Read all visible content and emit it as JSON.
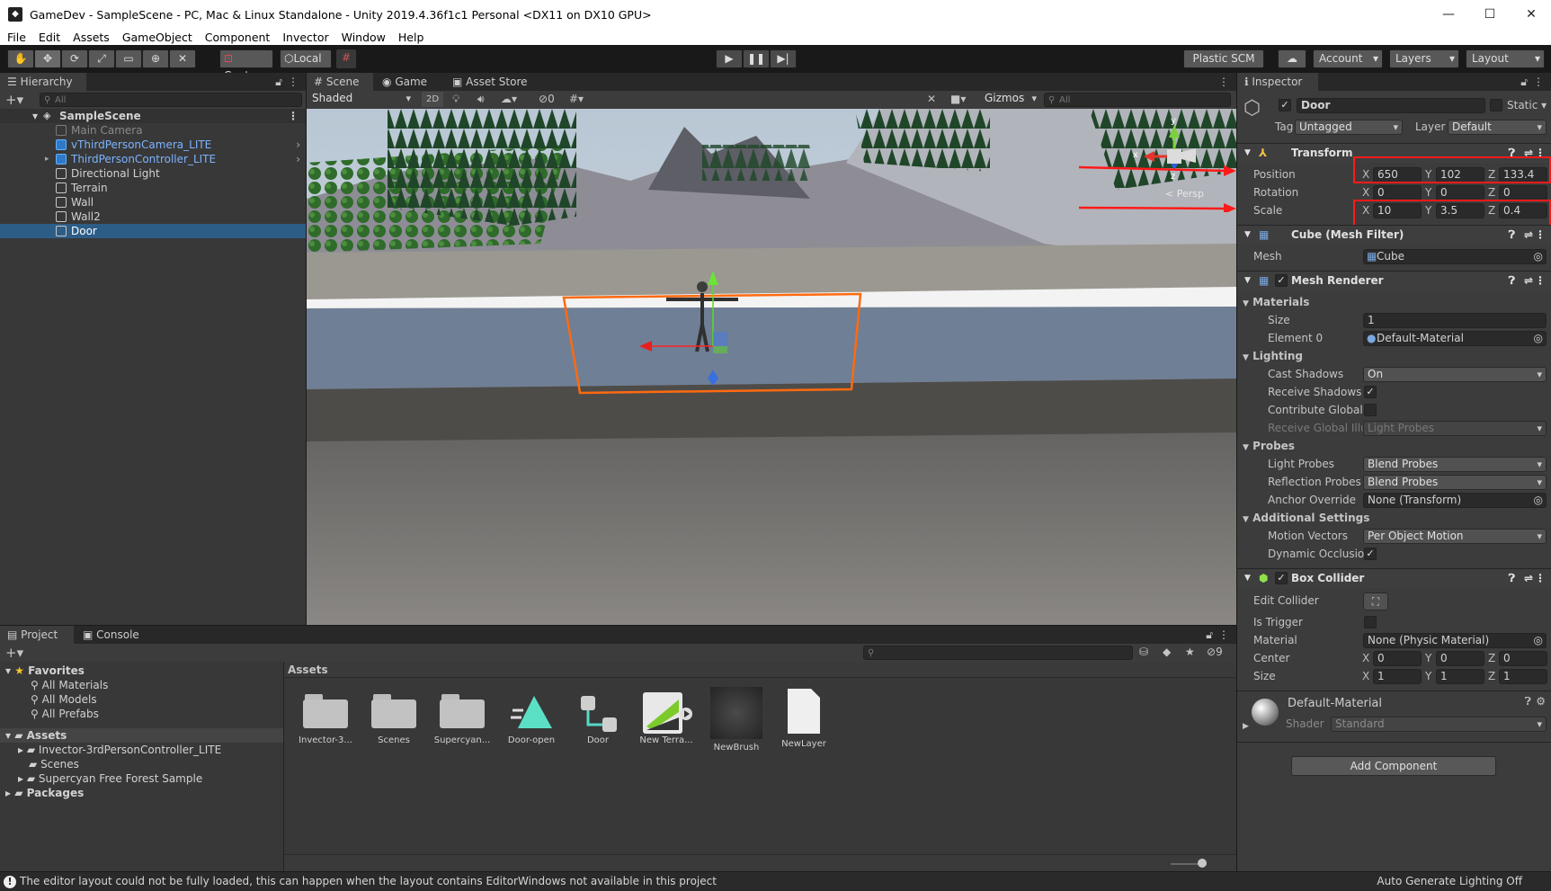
{
  "window": {
    "title": "GameDev - SampleScene - PC, Mac & Linux Standalone - Unity 2019.4.36f1c1 Personal <DX11 on DX10 GPU>",
    "minimize": "—",
    "maximize": "☐",
    "close": "✕"
  },
  "menu": [
    "File",
    "Edit",
    "Assets",
    "GameObject",
    "Component",
    "Invector",
    "Window",
    "Help"
  ],
  "toolbar": {
    "center": "Center",
    "local": "Local",
    "plastic": "Plastic SCM",
    "account": "Account",
    "layers": "Layers",
    "layout": "Layout"
  },
  "hierarchy": {
    "tab": "Hierarchy",
    "search_placeholder": "All",
    "scene": "SampleScene",
    "items": [
      {
        "label": "Main Camera",
        "color": "#8a8a8a"
      },
      {
        "label": "vThirdPersonCamera_LITE",
        "color": "#7cb3ff"
      },
      {
        "label": "ThirdPersonController_LITE",
        "color": "#7cb3ff"
      },
      {
        "label": "Directional Light",
        "color": "#d2d2d2"
      },
      {
        "label": "Terrain",
        "color": "#d2d2d2"
      },
      {
        "label": "Wall",
        "color": "#d2d2d2"
      },
      {
        "label": "Wall2",
        "color": "#d2d2d2"
      },
      {
        "label": "Door",
        "color": "#ffffff"
      }
    ]
  },
  "scene": {
    "tabs": [
      "Scene",
      "Game",
      "Asset Store"
    ],
    "shading": "Shaded",
    "mode2d": "2D",
    "hidden_count": "0",
    "gizmos": "Gizmos",
    "search_placeholder": "All",
    "persp": "Persp",
    "axis_x": "x",
    "axis_y": "y",
    "axis_z": "z"
  },
  "project": {
    "tabs": [
      "Project",
      "Console"
    ],
    "favorites": "Favorites",
    "favorites_items": [
      "All Materials",
      "All Models",
      "All Prefabs"
    ],
    "assets_root": "Assets",
    "assets_items": [
      "Invector-3rdPersonController_LITE",
      "Scenes",
      "Supercyan Free Forest Sample"
    ],
    "packages": "Packages",
    "breadcrumb": "Assets",
    "hidden_count": "9",
    "assets": [
      "Invector-3...",
      "Scenes",
      "Supercyan...",
      "Door-open",
      "Door",
      "New Terra...",
      "NewBrush",
      "NewLayer"
    ]
  },
  "inspector": {
    "tab": "Inspector",
    "object_name": "Door",
    "static": "Static",
    "tag_label": "Tag",
    "tag_value": "Untagged",
    "layer_label": "Layer",
    "layer_value": "Default",
    "transform": {
      "title": "Transform",
      "position_label": "Position",
      "rotation_label": "Rotation",
      "scale_label": "Scale",
      "position": {
        "x": "650",
        "y": "102",
        "z": "133.4"
      },
      "rotation": {
        "x": "0",
        "y": "0",
        "z": "0"
      },
      "scale": {
        "x": "10",
        "y": "3.5",
        "z": "0.4"
      }
    },
    "mesh_filter": {
      "title": "Cube (Mesh Filter)",
      "mesh_label": "Mesh",
      "mesh_value": "Cube"
    },
    "mesh_renderer": {
      "title": "Mesh Renderer",
      "materials": "Materials",
      "size_label": "Size",
      "size_value": "1",
      "element0_label": "Element 0",
      "element0_value": "Default-Material",
      "lighting": "Lighting",
      "cast_shadows_label": "Cast Shadows",
      "cast_shadows_value": "On",
      "receive_shadows_label": "Receive Shadows",
      "contribute_gi_label": "Contribute Global I",
      "receive_gi_label": "Receive Global Illu",
      "receive_gi_value": "Light Probes",
      "probes": "Probes",
      "light_probes_label": "Light Probes",
      "light_probes_value": "Blend Probes",
      "reflection_probes_label": "Reflection Probes",
      "reflection_probes_value": "Blend Probes",
      "anchor_override_label": "Anchor Override",
      "anchor_override_value": "None (Transform)",
      "additional": "Additional Settings",
      "motion_vectors_label": "Motion Vectors",
      "motion_vectors_value": "Per Object Motion",
      "dynamic_occlusion_label": "Dynamic Occlusior"
    },
    "box_collider": {
      "title": "Box Collider",
      "edit_collider_label": "Edit Collider",
      "is_trigger_label": "Is Trigger",
      "material_label": "Material",
      "material_value": "None (Physic Material)",
      "center_label": "Center",
      "size_label": "Size",
      "center": {
        "x": "0",
        "y": "0",
        "z": "0"
      },
      "size": {
        "x": "1",
        "y": "1",
        "z": "1"
      }
    },
    "material": {
      "name": "Default-Material",
      "shader_label": "Shader",
      "shader_value": "Standard"
    },
    "add_component": "Add Component"
  },
  "statusbar": {
    "message": "The editor layout could not be fully loaded, this can happen when the layout contains EditorWindows not available in this project",
    "right": "Auto Generate Lighting Off"
  }
}
